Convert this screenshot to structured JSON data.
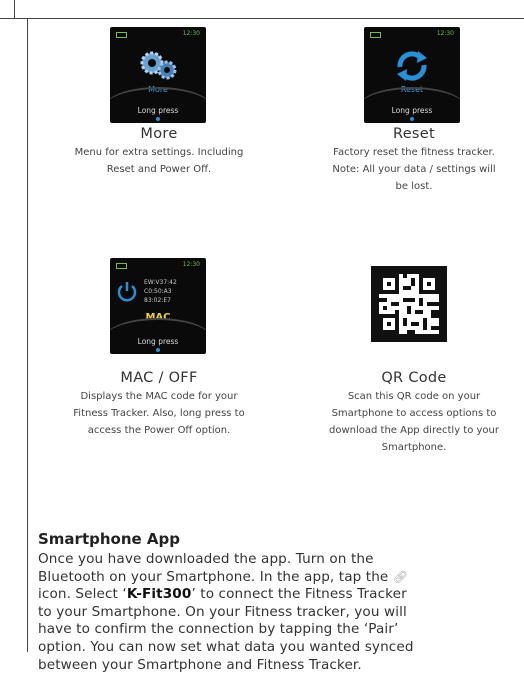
{
  "cells": {
    "more": {
      "title": "More",
      "desc_line1": "Menu for extra settings. Including",
      "desc_line2": "Reset and Power Off.",
      "screen": {
        "time": "12:30",
        "label": "More",
        "hint": "Long press",
        "icon": "gears-icon"
      }
    },
    "reset": {
      "title": "Reset",
      "desc_line1": "Factory reset the fitness tracker.",
      "desc_line2": "Note: All your data / settings will",
      "desc_line3": "be lost.",
      "screen": {
        "time": "12:30",
        "label": "Reset",
        "hint": "Long press",
        "icon": "refresh-icon"
      }
    },
    "mac": {
      "title": "MAC / OFF",
      "desc_line1": "Displays the MAC code for your",
      "desc_line2": "Fitness Tracker. Also, long press to",
      "desc_line3": "access the Power Off option.",
      "screen": {
        "time": "12:30",
        "label": "MAC",
        "hint": "Long press",
        "icon": "power-icon",
        "mac_line1": "EW:V37:42",
        "mac_line2": "C0:50:A3",
        "mac_line3": "83:02:E7"
      }
    },
    "qr": {
      "title": "QR Code",
      "desc_line1": "Scan this QR code on your",
      "desc_line2": "Smartphone to access options to",
      "desc_line3": "download the App directly to your",
      "desc_line4": "Smartphone."
    }
  },
  "section": {
    "title": "Smartphone App",
    "line1": "Once you have downloaded the app. Turn on the",
    "line2": "Bluetooth on your Smartphone. In the app, tap the",
    "line3_a": "icon. Select ‘",
    "line3_bold": "K-Fit300",
    "line3_b": "’ to connect the Fitness Tracker",
    "line4": "to your Smartphone. On your Fitness tracker, you will",
    "line5": "have to confirm the connection by tapping the ‘Pair’",
    "line6": "option. You can now set what data you wanted synced",
    "line7": "between your Smartphone and Fitness Tracker."
  },
  "colors": {
    "screen_bg": "#0a0a0a",
    "accent_blue": "#2a8fd6",
    "status_green": "#6fbf4a"
  }
}
